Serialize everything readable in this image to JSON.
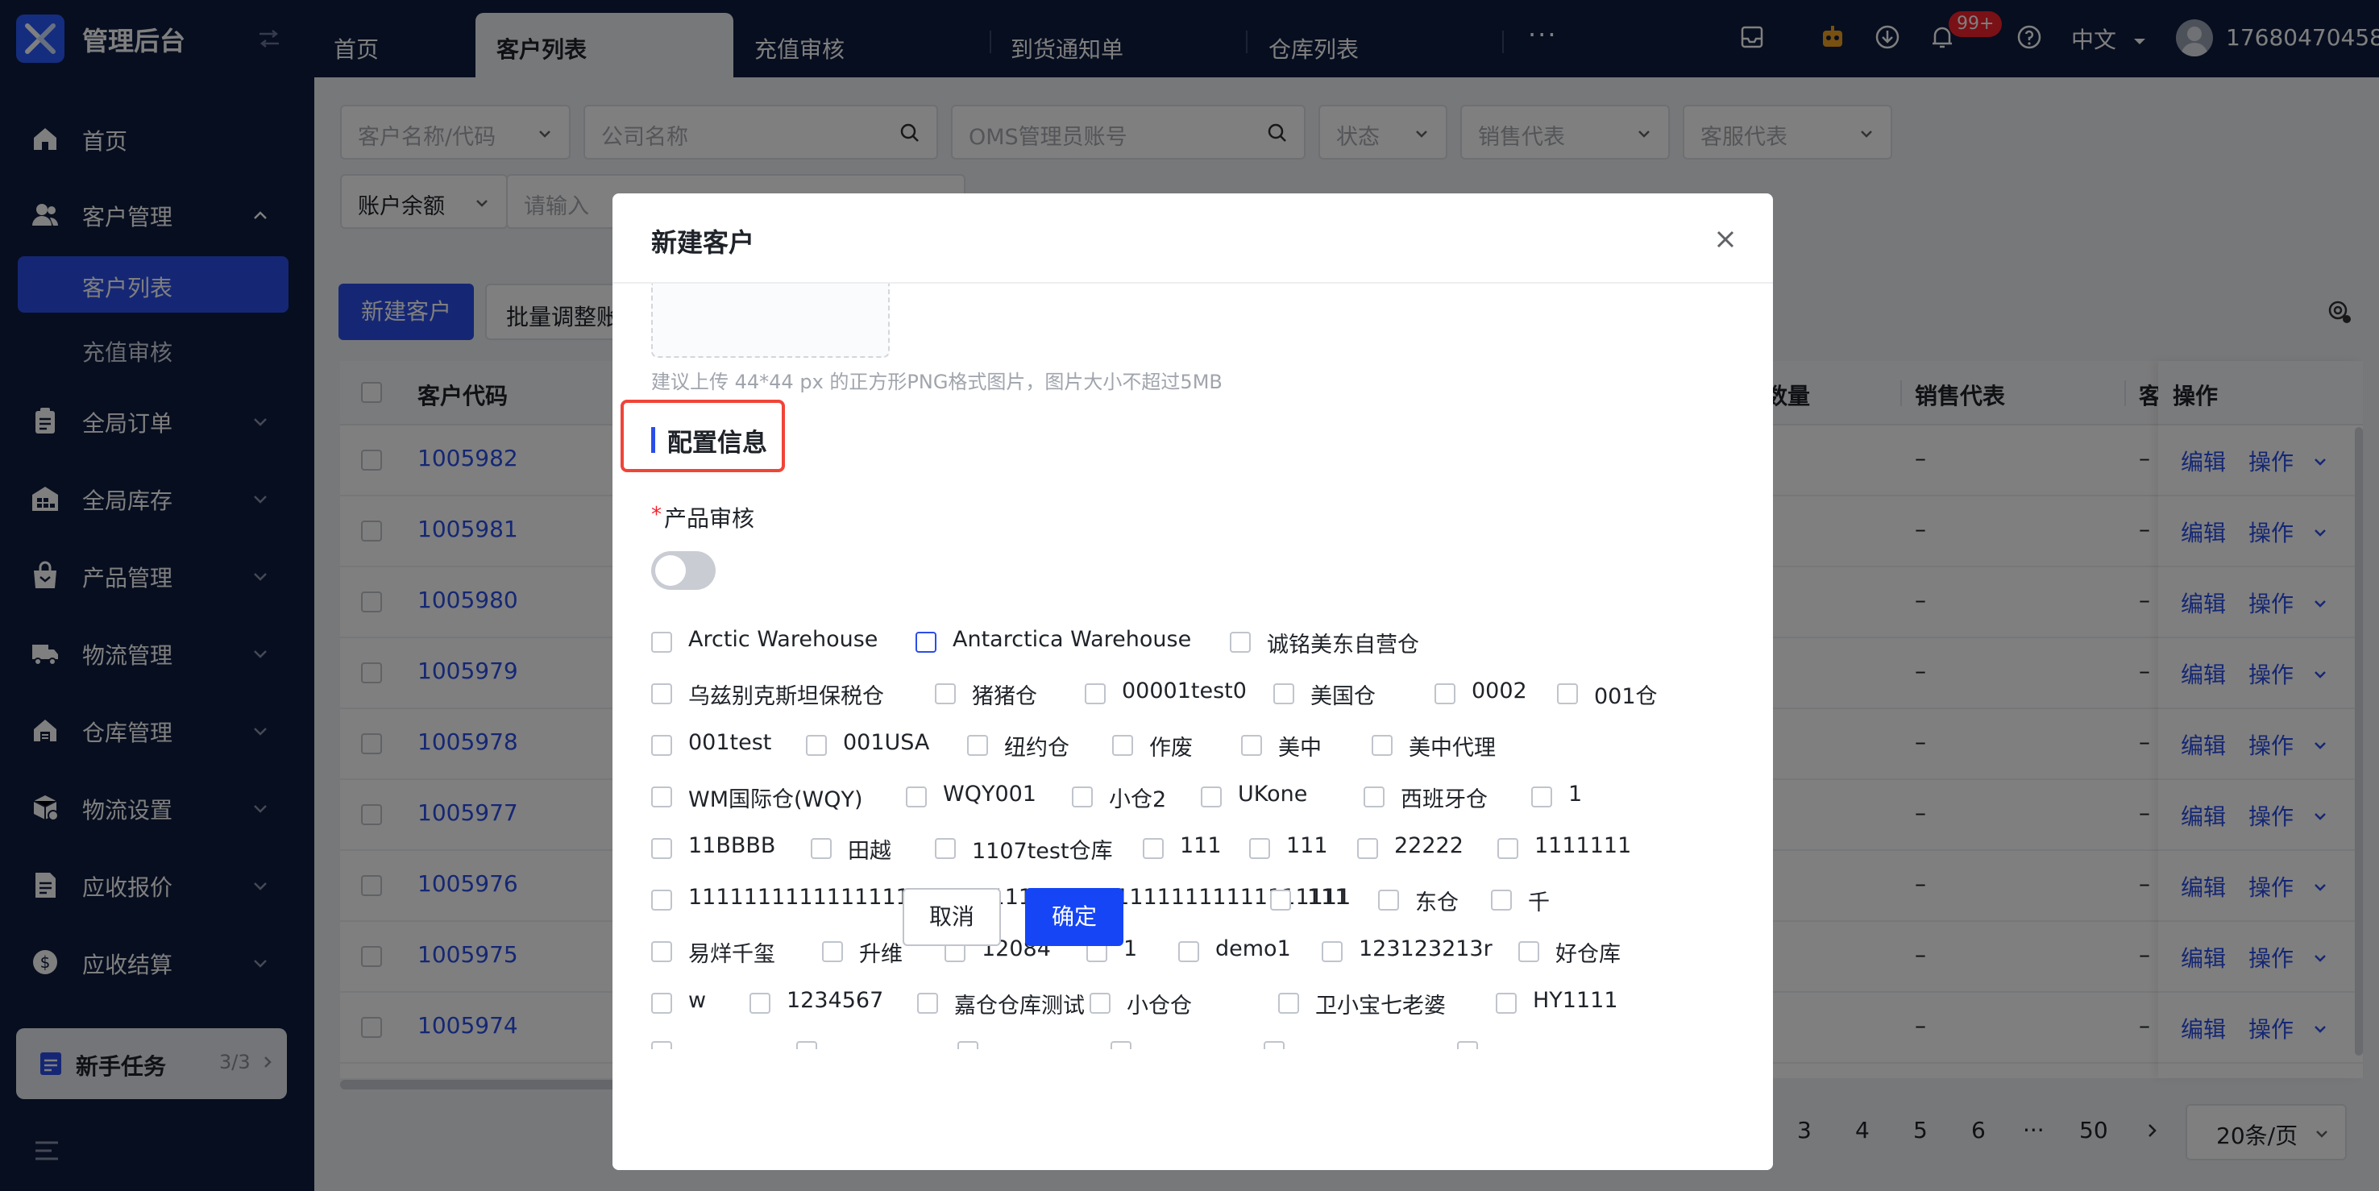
{
  "app": {
    "brand": "管理后台"
  },
  "top_tabs": [
    "首页",
    "客户列表",
    "充值审核",
    "到货通知单",
    "仓库列表"
  ],
  "top_right": {
    "notification_badge": "99+",
    "language": "中文",
    "username": "17680470458"
  },
  "sidebar": {
    "items": [
      {
        "label": "首页",
        "icon": "home-icon"
      },
      {
        "label": "客户管理",
        "icon": "users-icon",
        "expanded": true
      },
      {
        "label": "全局订单",
        "icon": "clipboard-icon"
      },
      {
        "label": "全局库存",
        "icon": "warehouse-icon"
      },
      {
        "label": "产品管理",
        "icon": "bag-icon"
      },
      {
        "label": "物流管理",
        "icon": "truck-icon"
      },
      {
        "label": "仓库管理",
        "icon": "home-store-icon"
      },
      {
        "label": "物流设置",
        "icon": "box-gear-icon"
      },
      {
        "label": "应收报价",
        "icon": "document-icon"
      },
      {
        "label": "应收结算",
        "icon": "dollar-icon"
      }
    ],
    "sub_items": [
      {
        "label": "客户列表",
        "active": true
      },
      {
        "label": "充值审核",
        "active": false
      }
    ],
    "task": {
      "label": "新手任务",
      "count": "3/3"
    }
  },
  "filters": {
    "customer_name_placeholder": "客户名称/代码",
    "company_placeholder": "公司名称",
    "oms_placeholder": "OMS管理员账号",
    "status_placeholder": "状态",
    "sales_placeholder": "销售代表",
    "service_placeholder": "客服代表",
    "balance_select": "账户余额",
    "balance_placeholder": "请输入"
  },
  "toolbar": {
    "new_customer": "新建客户",
    "batch_adjust": "批量调整账"
  },
  "table": {
    "headers": {
      "code": "客户代码",
      "quantity": "数量",
      "sales": "销售代表",
      "service": "客",
      "ops": "操作"
    },
    "rows": [
      "1005982",
      "1005981",
      "1005980",
      "1005979",
      "1005978",
      "1005977",
      "1005976",
      "1005975",
      "1005974"
    ],
    "dash": "–",
    "edit_label": "编辑",
    "more_label": "操作"
  },
  "pagination": {
    "pages": [
      "3",
      "4",
      "5",
      "6"
    ],
    "ellipsis": "···",
    "last": "50",
    "page_size": "20条/页"
  },
  "modal": {
    "title": "新建客户",
    "upload_hint": "建议上传 44*44 px 的正方形PNG格式图片，图片大小不超过5MB",
    "section_title": "配置信息",
    "required_label": "产品审核",
    "toggle_on": false,
    "warehouses": [
      [
        "Arctic Warehouse",
        "Antarctica Warehouse",
        "诚铭美东自营仓"
      ],
      [
        "乌兹别克斯坦保税仓",
        "猪猪仓",
        "00001test0",
        "美国仓",
        "0002",
        "001仓"
      ],
      [
        "001test",
        "001USA",
        "纽约仓",
        "作废",
        "美中",
        "美中代理"
      ],
      [
        "WM国际仓(WQY)",
        "WQY001",
        "小仓2",
        "UKone",
        "西班牙仓",
        "1"
      ],
      [
        "11BBBB",
        "田越",
        "1107test仓库",
        "111",
        "111",
        "22222",
        "1111111"
      ],
      [
        "1111111111111111111",
        "11111111111111111111111111111",
        "111",
        "东仓",
        "千"
      ],
      [
        "易烊千玺",
        "升维",
        "12084",
        "1",
        "demo1",
        "123123213r",
        "好仓库"
      ],
      [
        "w",
        "1234567",
        "嘉仓仓库测试",
        "小仓仓",
        "卫小宝七老婆",
        "HY1111"
      ]
    ],
    "cancel_label": "取消",
    "ok_label": "确定"
  }
}
